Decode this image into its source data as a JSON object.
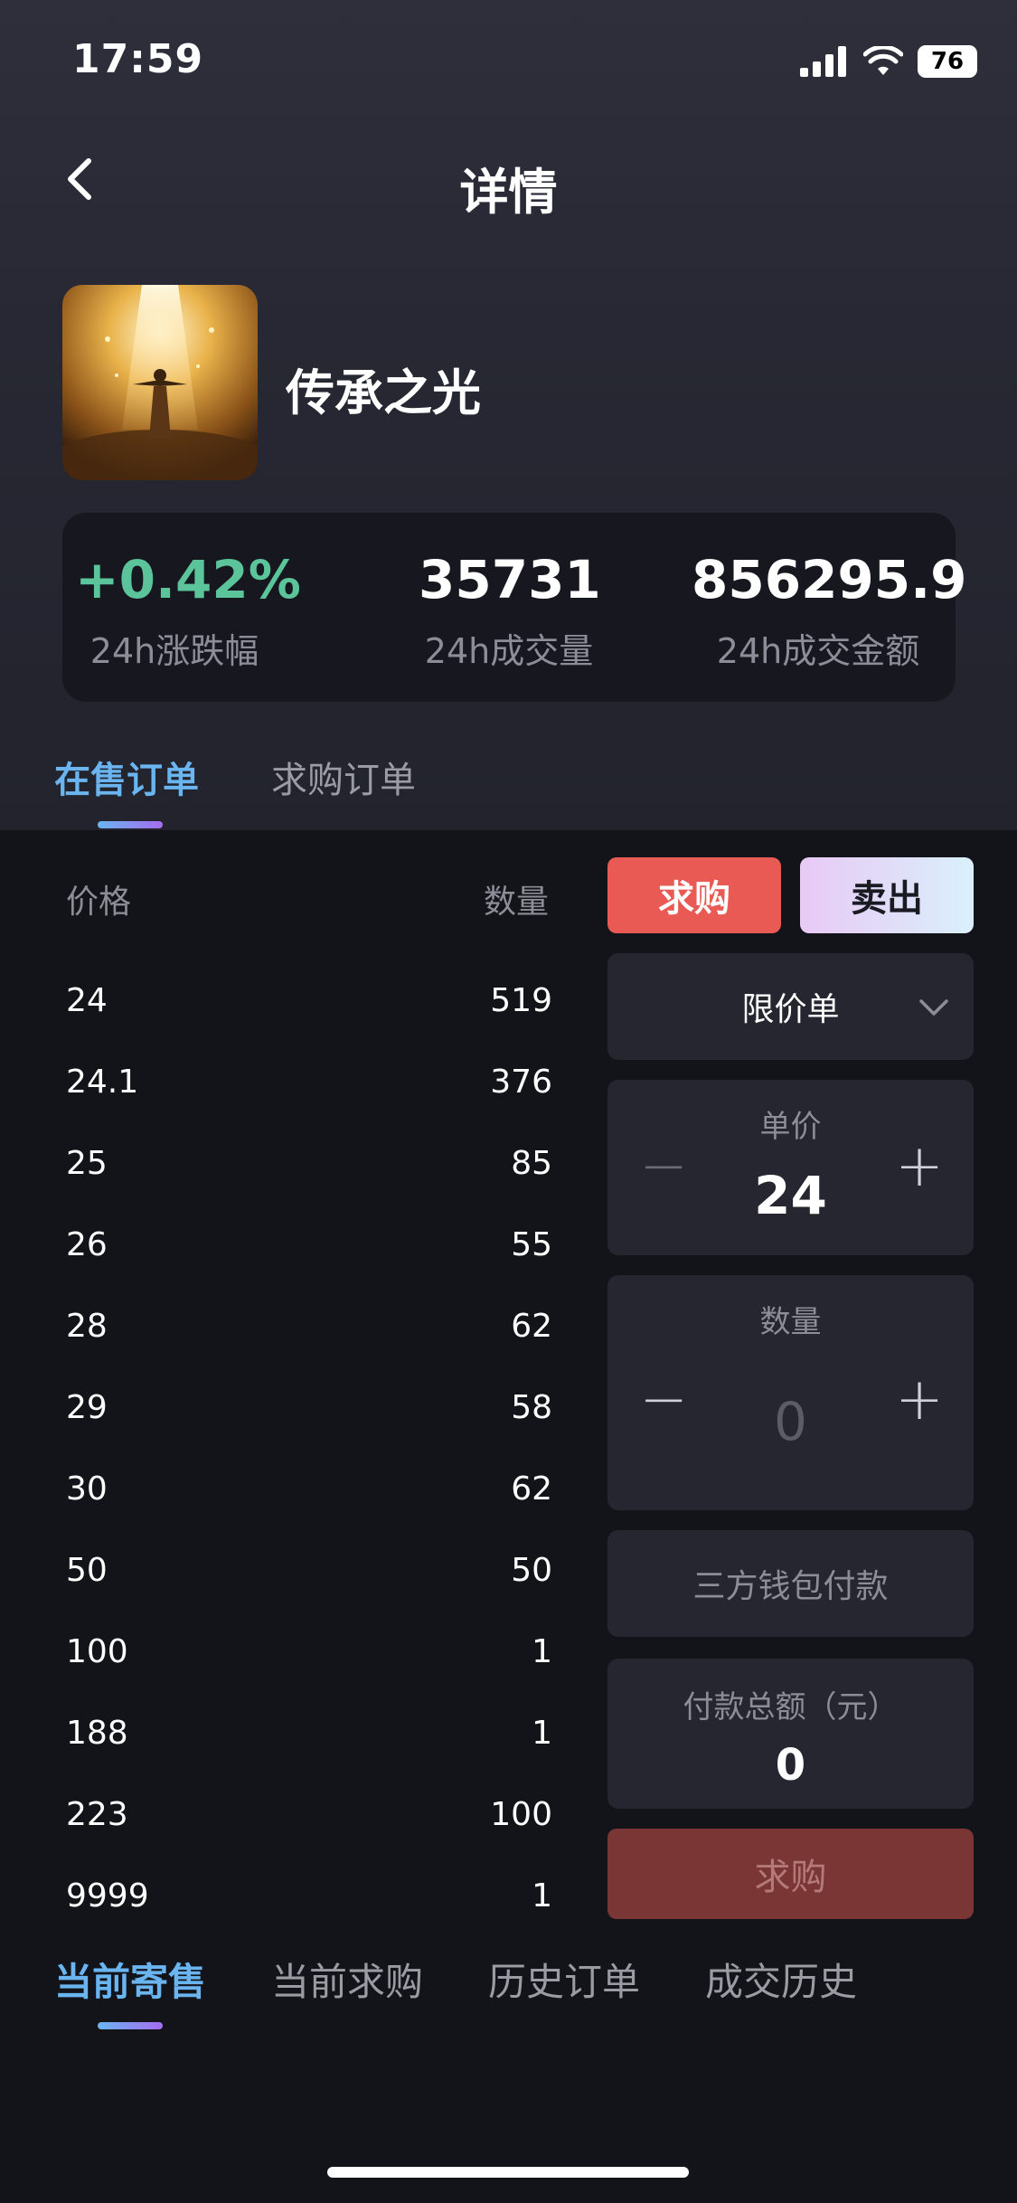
{
  "status_bar": {
    "time": "17:59",
    "battery": "76"
  },
  "nav": {
    "title": "详情"
  },
  "product": {
    "name": "传承之光"
  },
  "stats": [
    {
      "value": "+0.42%",
      "label": "24h涨跌幅",
      "color": "#5bc49a"
    },
    {
      "value": "35731",
      "label": "24h成交量"
    },
    {
      "value": "856295.9",
      "label": "24h成交金额"
    }
  ],
  "top_tabs": [
    {
      "label": "在售订单",
      "active": true
    },
    {
      "label": "求购订单",
      "active": false
    }
  ],
  "order_book": {
    "price_header": "价格",
    "qty_header": "数量",
    "rows": [
      {
        "price": "24",
        "qty": "519"
      },
      {
        "price": "24.1",
        "qty": "376"
      },
      {
        "price": "25",
        "qty": "85"
      },
      {
        "price": "26",
        "qty": "55"
      },
      {
        "price": "28",
        "qty": "62"
      },
      {
        "price": "29",
        "qty": "58"
      },
      {
        "price": "30",
        "qty": "62"
      },
      {
        "price": "50",
        "qty": "50"
      },
      {
        "price": "100",
        "qty": "1"
      },
      {
        "price": "188",
        "qty": "1"
      },
      {
        "price": "223",
        "qty": "100"
      },
      {
        "price": "9999",
        "qty": "1"
      }
    ]
  },
  "panel": {
    "buy_label": "求购",
    "sell_label": "卖出",
    "order_type": "限价单",
    "unit_price_label": "单价",
    "unit_price_value": "24",
    "quantity_label": "数量",
    "quantity_value": "0",
    "payment_method": "三方钱包付款",
    "total_label": "付款总额（元）",
    "total_value": "0",
    "submit_label": "求购"
  },
  "bottom_tabs": [
    {
      "label": "当前寄售",
      "active": true
    },
    {
      "label": "当前求购",
      "active": false
    },
    {
      "label": "历史订单",
      "active": false
    },
    {
      "label": "成交历史",
      "active": false
    }
  ],
  "colors": {
    "accent_blue": "#6ab4f0",
    "accent_purple": "#a56cf0",
    "buy_red": "#e95a55",
    "positive_green": "#5bc49a"
  }
}
